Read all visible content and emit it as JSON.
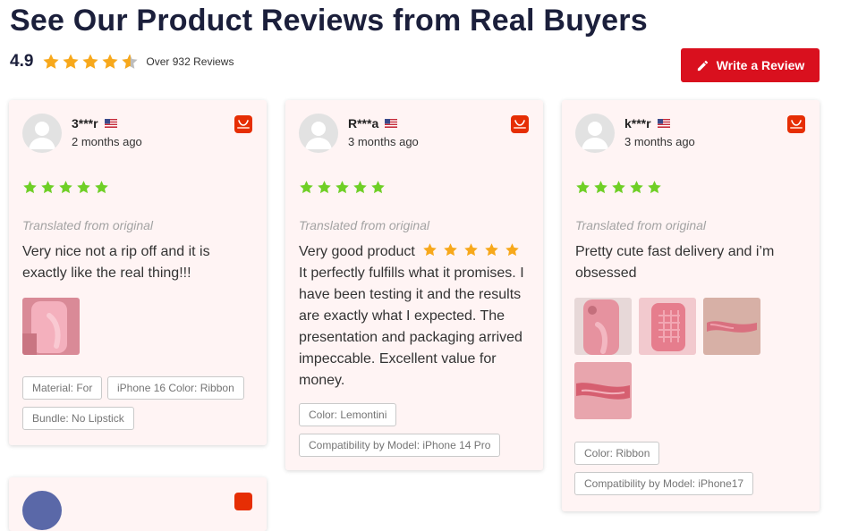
{
  "header": {
    "title": "See Our Product Reviews from Real Buyers",
    "rating": "4.9",
    "rating_value": 4.9,
    "review_count": "Over 932 Reviews",
    "write_review_label": "Write a Review"
  },
  "colors": {
    "primary_red": "#d9101e",
    "star_gold": "#f7a81b",
    "star_green": "#6fcf26",
    "card_bg": "#fff4f4",
    "title_navy": "#1b1f3b"
  },
  "reviews": [
    {
      "user": "3***r",
      "flag": "us-flag-icon",
      "time": "2 months ago",
      "stars": 5,
      "translated_label": "Translated from original",
      "text": "Very nice not a rip off and it is exactly like the real thing!!!",
      "images": [
        "pink-phone-case-photo"
      ],
      "tags": [
        "Material: For",
        "iPhone 16 Color: Ribbon",
        "Bundle: No Lipstick"
      ]
    },
    {
      "user": "R***a",
      "flag": "us-flag-icon",
      "time": "3 months ago",
      "stars": 5,
      "translated_label": "Translated from original",
      "text_lead": "Very good product",
      "text_lead_stars": 5,
      "text": "It perfectly fulfills what it promises. I have been testing it and the results are exactly what I expected. The presentation and packaging arrived impeccable. Excellent value for money.",
      "images": [],
      "tags": [
        "Color: Lemontini",
        "Compatibility by Model: iPhone 14 Pro"
      ]
    },
    {
      "user": "k***r",
      "flag": "us-flag-icon",
      "time": "3 months ago",
      "stars": 5,
      "translated_label": "Translated from original",
      "text": "Pretty cute fast delivery and i’m obsessed",
      "images": [
        "pink-case-back-photo",
        "pink-case-grid-photo",
        "pink-bow-photo",
        "pink-bow-closeup-photo"
      ],
      "tags": [
        "Color: Ribbon",
        "Compatibility by Model: iPhone17"
      ]
    }
  ]
}
